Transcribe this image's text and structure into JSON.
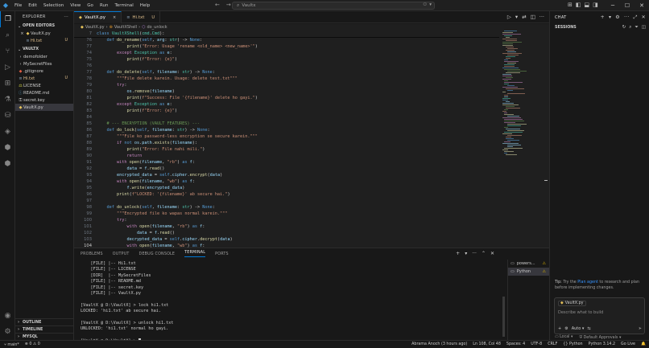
{
  "titlebar": {
    "menu": [
      "File",
      "Edit",
      "Selection",
      "View",
      "Go",
      "Run",
      "Terminal",
      "Help"
    ],
    "search_text": "Vaultx"
  },
  "sidebar": {
    "title": "EXPLORER",
    "open_editors_label": "OPEN EDITORS",
    "open_editors": [
      {
        "name": "VaultX.py",
        "badge": ""
      },
      {
        "name": "Hi.txt",
        "badge": "U"
      }
    ],
    "workspace_label": "VAULTX",
    "files": [
      {
        "name": "demofolder",
        "type": "folder",
        "badge": ""
      },
      {
        "name": "MySecretFiles",
        "type": "folder",
        "badge": ""
      },
      {
        "name": ".gitignore",
        "type": "file",
        "badge": ""
      },
      {
        "name": "Hi.txt",
        "type": "file",
        "badge": "U"
      },
      {
        "name": "LICENSE",
        "type": "file",
        "badge": ""
      },
      {
        "name": "README.md",
        "type": "file",
        "badge": ""
      },
      {
        "name": "secret.key",
        "type": "file",
        "badge": ""
      },
      {
        "name": "VaultX.py",
        "type": "file",
        "badge": ""
      }
    ],
    "bottom_sections": [
      "OUTLINE",
      "TIMELINE",
      "MYSQL"
    ]
  },
  "tabs": [
    {
      "label": "VaultX.py",
      "active": true,
      "badge": "×"
    },
    {
      "label": "Hi.txt",
      "active": false,
      "badge": "U"
    }
  ],
  "breadcrumb": [
    "VaultX.py",
    "VaultXShell",
    "do_unlock"
  ],
  "editor": {
    "lines": [
      {
        "n": "7",
        "c": "class VaultXShell(cmd.Cmd):"
      },
      {
        "n": "76",
        "c": "    def do_rename(self, arg: str) -> None:"
      },
      {
        "n": "77",
        "c": "            print(\"Error: Usage 'rename <old_name> <new_name>'\")"
      },
      {
        "n": "74",
        "c": "        except Exception as e:"
      },
      {
        "n": "75",
        "c": "            print(f\"Error: {e}\")"
      },
      {
        "n": "76",
        "c": ""
      },
      {
        "n": "77",
        "c": "    def do_delete(self, filename: str) -> None:"
      },
      {
        "n": "78",
        "c": "        \"\"\"File delete karein. Usage: delete test.txt\"\"\""
      },
      {
        "n": "79",
        "c": "        try:"
      },
      {
        "n": "80",
        "c": "            os.remove(filename)"
      },
      {
        "n": "81",
        "c": "            print(f\"Success: File '{filename}' delete ho gayi.\")"
      },
      {
        "n": "82",
        "c": "        except Exception as e:"
      },
      {
        "n": "83",
        "c": "            print(f\"Error: {e}\")"
      },
      {
        "n": "84",
        "c": ""
      },
      {
        "n": "85",
        "c": "    # --- ENCRYPTION (VAULT FEATURES) ---"
      },
      {
        "n": "86",
        "c": "    def do_lock(self, filename: str) -> None:"
      },
      {
        "n": "87",
        "c": "        \"\"\"File ko password-less encryption se secure karein.\"\"\""
      },
      {
        "n": "88",
        "c": "        if not os.path.exists(filename):"
      },
      {
        "n": "89",
        "c": "            print(\"Error: File nahi mili.\")"
      },
      {
        "n": "90",
        "c": "            return"
      },
      {
        "n": "91",
        "c": "        with open(filename, \"rb\") as f:"
      },
      {
        "n": "92",
        "c": "            data = f.read()"
      },
      {
        "n": "93",
        "c": "        encrypted_data = self.cipher.encrypt(data)"
      },
      {
        "n": "94",
        "c": "        with open(filename, \"wb\") as f:"
      },
      {
        "n": "95",
        "c": "            f.write(encrypted_data)"
      },
      {
        "n": "96",
        "c": "        print(f\"LOCKED: '{filename}' ab secure hai.\")"
      },
      {
        "n": "97",
        "c": ""
      },
      {
        "n": "98",
        "c": "    def do_unlock(self, filename: str) -> None:"
      },
      {
        "n": "99",
        "c": "        \"\"\"Encrypted file ko wapas normal karein.\"\"\""
      },
      {
        "n": "100",
        "c": "        try:"
      },
      {
        "n": "101",
        "c": "            with open(filename, \"rb\") as f:"
      },
      {
        "n": "102",
        "c": "                data = f.read()"
      },
      {
        "n": "103",
        "c": "            decrypted_data = self.cipher.decrypt(data)"
      },
      {
        "n": "104",
        "c": "            with open(filename, \"wb\") as f:"
      }
    ]
  },
  "panel": {
    "tabs": [
      "PROBLEMS",
      "OUTPUT",
      "DEBUG CONSOLE",
      "TERMINAL",
      "PORTS"
    ],
    "active_tab": "TERMINAL",
    "terminal_lines": [
      "    [FILE] |-- Hi1.txt",
      "    [FILE] |-- LICENSE",
      "    [DIR]  |-- MySecretFiles",
      "    [FILE] |-- README.md",
      "    [FILE] |-- secret.key",
      "    [FILE] |-- VaultX.py",
      "",
      "[VaultX @ D:\\VaultX] > lock hi1.txt",
      "LOCKED: 'hi1.txt' ab secure hai.",
      "",
      "[VaultX @ D:\\VaultX] > unlock hi1.txt",
      "UNLOCKED: 'hi1.txt' normal ho gayi.",
      "",
      "[VaultX @ D:\\VaultX] > "
    ],
    "terminals": [
      "powers...",
      "Python"
    ]
  },
  "chat": {
    "title": "CHAT",
    "sessions_label": "SESSIONS",
    "tip_prefix": "Tip:",
    "tip_pre": "Try the",
    "tip_link": "Plan agent",
    "tip_post": "to research and plan before implementing changes.",
    "context_chip": "VaultX.py",
    "placeholder": "Describe what to build",
    "mode": "Auto",
    "local_label": "Local",
    "approvals_label": "Default Approvals"
  },
  "status": {
    "left": [
      "main*",
      "0 ⚠ 0"
    ],
    "right": [
      "Abrama Anoch (3 hours ago)",
      "Ln 108, Col 48",
      "Spaces: 4",
      "UTF-8",
      "CRLF",
      "{} Python",
      "Python 3.14.2",
      "Go Live"
    ]
  }
}
